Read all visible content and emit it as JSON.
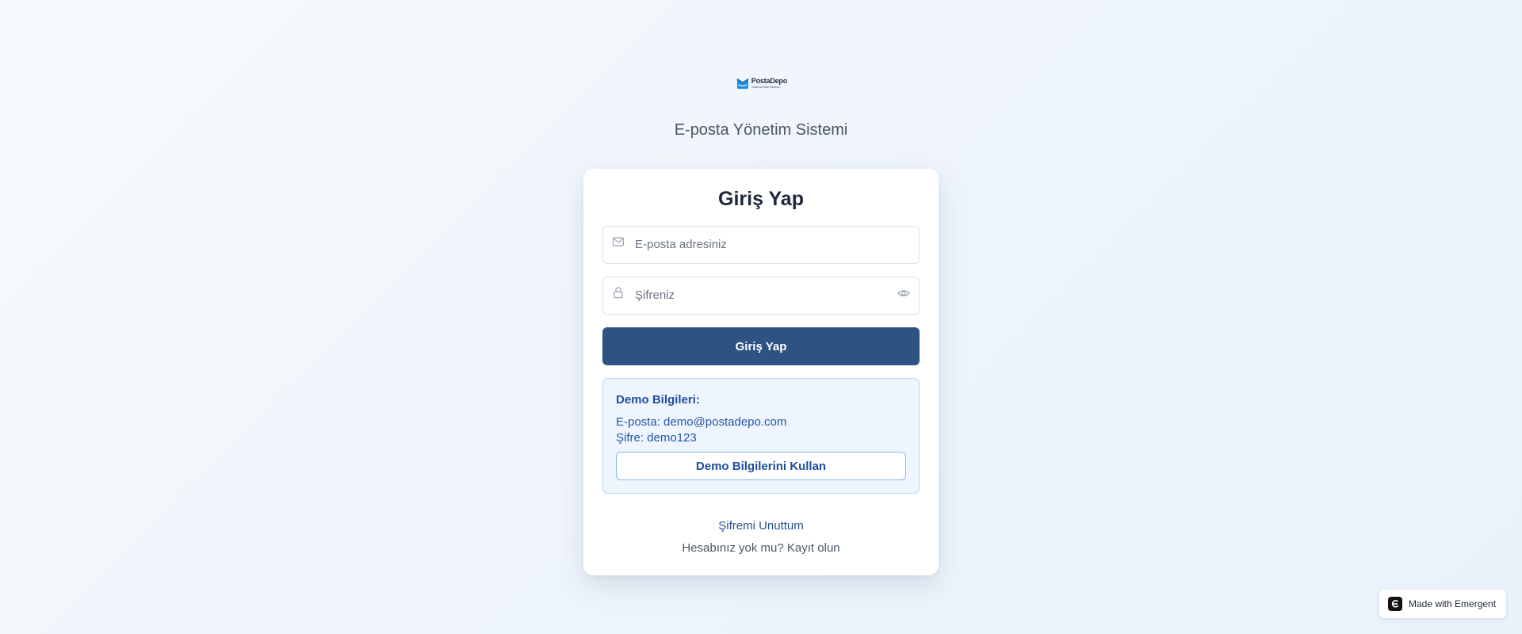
{
  "brand": {
    "name": "PostaDepo",
    "tagline": "Outlook Mail Backup",
    "logo_icon": "envelope-logo-icon",
    "accent_color": "#1a8fe3"
  },
  "subtitle": "E-posta Yönetim Sistemi",
  "login": {
    "title": "Giriş Yap",
    "email_placeholder": "E-posta adresiniz",
    "email_icon": "mail-icon",
    "password_placeholder": "Şifreniz",
    "password_icon": "lock-icon",
    "password_toggle_icon": "eye-icon",
    "submit_label": "Giriş Yap",
    "submit_color": "#2e5283"
  },
  "demo": {
    "title": "Demo Bilgileri:",
    "email_line": "E-posta: demo@postadepo.com",
    "password_line": "Şifre: demo123",
    "button_label": "Demo Bilgilerini Kullan"
  },
  "links": {
    "forgot_password": "Şifremi Unuttum",
    "register_prompt": "Hesabınız yok mu?",
    "register_link": "Kayıt olun"
  },
  "badge": {
    "label": "Made with Emergent",
    "icon": "emergent-logo-icon"
  }
}
